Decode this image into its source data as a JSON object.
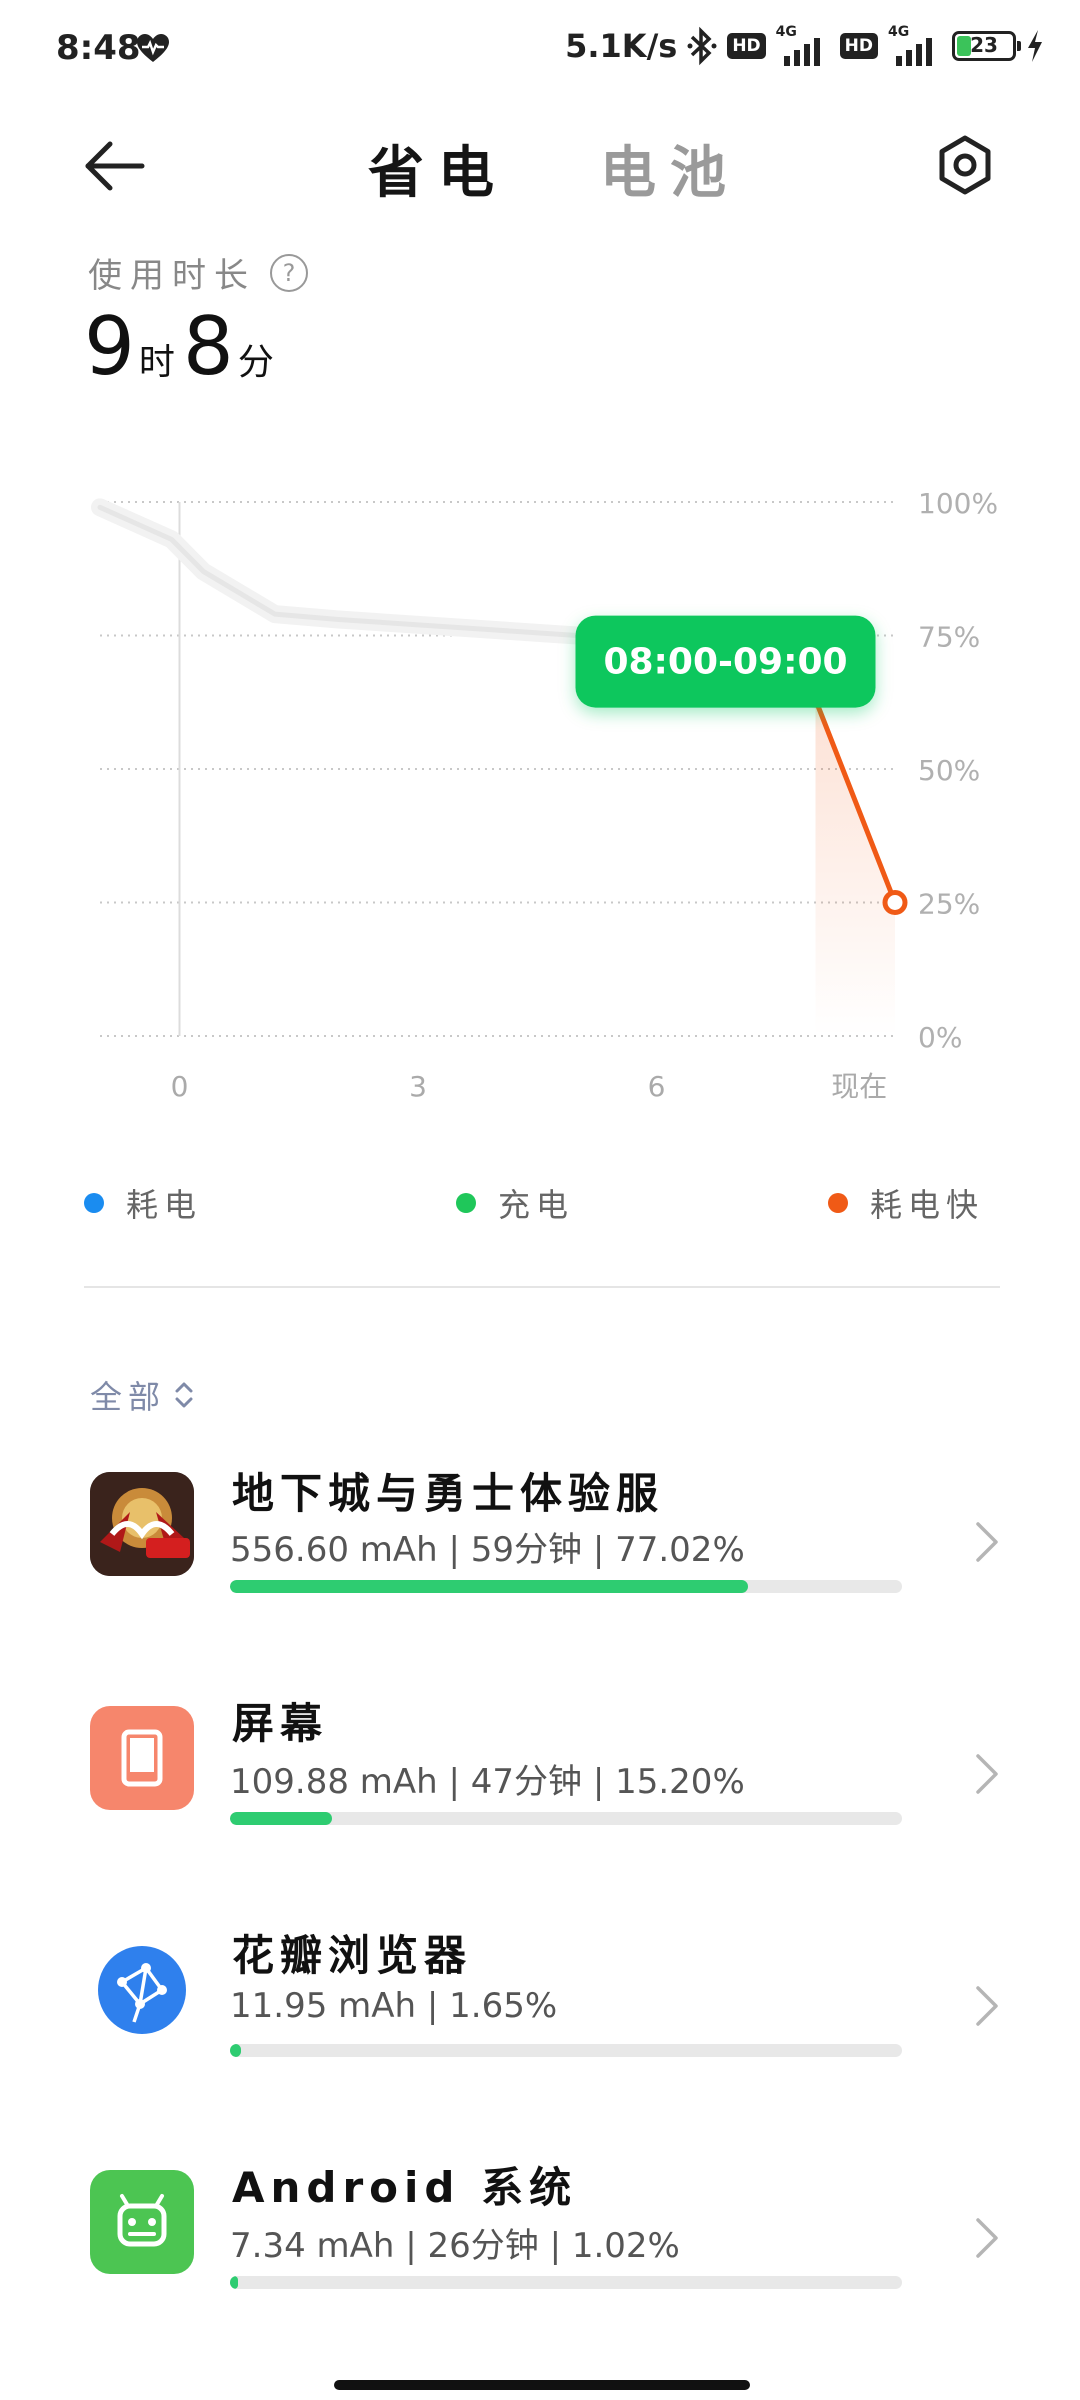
{
  "status_bar": {
    "time": "8:48",
    "net_speed": "5.1K/s",
    "hd": "HD",
    "net_type": "4G",
    "battery": "23"
  },
  "header": {
    "tab_power_saving": "省电",
    "tab_battery": "电池"
  },
  "usage": {
    "label": "使用时长",
    "hours": "9",
    "hours_unit": "时",
    "minutes": "8",
    "minutes_unit": "分"
  },
  "chart_data": {
    "type": "line",
    "x_tick_labels": [
      "0",
      "3",
      "6",
      "现在"
    ],
    "y_tick_labels": [
      "100%",
      "75%",
      "50%",
      "25%",
      "0%"
    ],
    "ylim": [
      0,
      100
    ],
    "xlim": [
      -1,
      9
    ],
    "series": [
      {
        "x": [
          -1,
          -0.1,
          0.3,
          1.2,
          2,
          3,
          4,
          5,
          6,
          7,
          8
        ],
        "values": [
          99,
          93,
          87,
          79,
          78,
          77,
          76,
          75,
          74,
          73,
          63
        ]
      },
      {
        "x": [
          8,
          9
        ],
        "values": [
          63,
          25
        ]
      }
    ],
    "tooltip": "08:00-09:00",
    "colors": {
      "gray_line": "#e6e6e6",
      "fast_drain": "#f05a16",
      "tooltip_bg": "#10c75d"
    }
  },
  "legend": [
    {
      "label": "耗电",
      "color": "#1a8cf0"
    },
    {
      "label": "充电",
      "color": "#1fc75a"
    },
    {
      "label": "耗电快",
      "color": "#f05a16"
    }
  ],
  "filter": {
    "label": "全部"
  },
  "apps": [
    {
      "name": "地下城与勇士体验服",
      "stats": "556.60 mAh | 59分钟 | 77.02%",
      "percent": 77.02,
      "icon": "dnf-game-icon"
    },
    {
      "name": "屏幕",
      "stats": "109.88 mAh | 47分钟 | 15.20%",
      "percent": 15.2,
      "icon": "screen-icon"
    },
    {
      "name": "花瓣浏览器",
      "stats": "11.95 mAh | 1.65%",
      "percent": 1.65,
      "icon": "browser-icon"
    },
    {
      "name": "Android 系统",
      "stats": "7.34 mAh | 26分钟 | 1.02%",
      "percent": 1.02,
      "icon": "android-icon"
    }
  ]
}
